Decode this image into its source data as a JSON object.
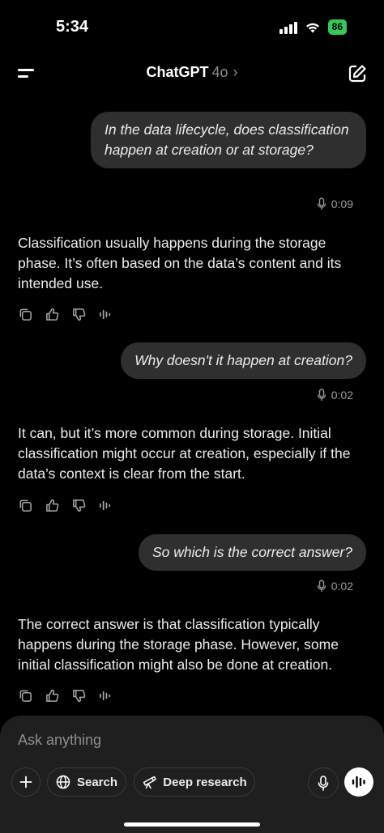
{
  "status_bar": {
    "time": "5:34",
    "battery": "86"
  },
  "header": {
    "title": "ChatGPT",
    "model": "4o",
    "chevron": "›",
    "menu_icon": "menu-icon",
    "compose_icon": "new-chat-icon"
  },
  "messages": [
    {
      "role": "user",
      "text": "In the data lifecycle, does classification happen at creation or at storage?",
      "duration": "0:09"
    },
    {
      "role": "assistant",
      "text": "Classification usually happens during the storage phase. It’s often based on the data’s content and its intended use."
    },
    {
      "role": "user",
      "text": "Why doesn't it happen at creation?",
      "duration": "0:02"
    },
    {
      "role": "assistant",
      "text": "It can, but it’s more common during storage. Initial classification might occur at creation, especially if the data’s context is clear from the start."
    },
    {
      "role": "user",
      "text": "So which is the correct answer?",
      "duration": "0:02"
    },
    {
      "role": "assistant",
      "text": "The correct answer is that classification typically happens during the storage phase. However, some initial classification might also be done at creation."
    }
  ],
  "message_actions": [
    "copy-icon",
    "thumbs-up-icon",
    "thumbs-down-icon",
    "read-aloud-icon"
  ],
  "composer": {
    "placeholder": "Ask anything",
    "plus_label": "+",
    "search_label": "Search",
    "deep_research_label": "Deep research"
  },
  "colors": {
    "background": "#000000",
    "bubble": "#2f2f2f",
    "composer": "#1f1f1f",
    "battery": "#34c759"
  }
}
